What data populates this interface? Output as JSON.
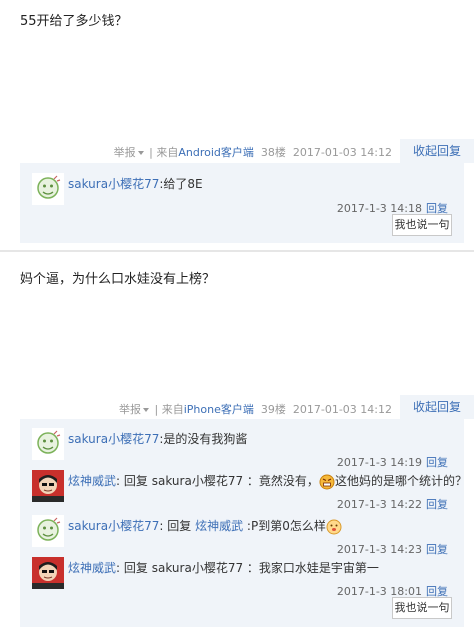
{
  "posts": [
    {
      "content": "55开给了多少钱？",
      "meta": {
        "report": "举报",
        "source_prefix": "| 来自",
        "device": "Android客户端",
        "floor": "38楼",
        "time": "2017-01-03 14:12"
      },
      "fold_label": "收起回复",
      "replies": [
        {
          "user": "sakura小樱花77",
          "colon": ":",
          "text": "给了8E",
          "time": "2017-1-3 14:18",
          "reply_label": "回复"
        }
      ],
      "say_label": "我也说一句"
    },
    {
      "content": "妈个逼，为什么口水娃没有上榜？",
      "meta": {
        "report": "举报",
        "source_prefix": "| 来自",
        "device": "iPhone客户端",
        "floor": "39楼",
        "time": "2017-01-03 14:12"
      },
      "fold_label": "收起回复",
      "replies": [
        {
          "user": "sakura小樱花77",
          "colon": ":",
          "text": "是的没有我狗酱",
          "time": "2017-1-3 14:19",
          "reply_label": "回复"
        },
        {
          "user": "炫神威武",
          "colon": ":",
          "pre": "回复",
          "target": "sakura小樱花77",
          "text": "：竟然没有，",
          "emoji": "angry-face",
          "text2": "这他妈的是哪个统计的？",
          "time": "2017-1-3 14:22",
          "reply_label": "回复"
        },
        {
          "user": "sakura小樱花77",
          "colon": ":",
          "pre": "回复",
          "target": "炫神威武",
          "text": ":P到第0怎么样",
          "emoji": "smile-face",
          "time": "2017-1-3 14:23",
          "reply_label": "回复"
        },
        {
          "user": "炫神威武",
          "colon": ":",
          "pre": "回复",
          "target": "sakura小樱花77",
          "text": "：我家口水娃是宇宙第一",
          "time": "2017-1-3 18:01",
          "reply_label": "回复"
        }
      ],
      "say_label": "我也说一句"
    }
  ]
}
